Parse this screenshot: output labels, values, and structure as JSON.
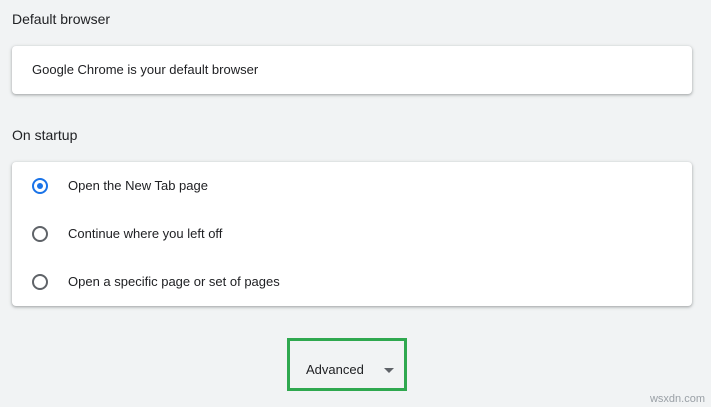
{
  "default_browser": {
    "section_title": "Default browser",
    "status_text": "Google Chrome is your default browser"
  },
  "on_startup": {
    "section_title": "On startup",
    "selected_index": 0,
    "options": [
      {
        "label": "Open the New Tab page",
        "checked": true
      },
      {
        "label": "Continue where you left off",
        "checked": false
      },
      {
        "label": "Open a specific page or set of pages",
        "checked": false
      }
    ]
  },
  "advanced": {
    "label": "Advanced",
    "icon": "arrow-drop-down-icon",
    "highlight_color": "#2fa84f"
  },
  "watermark": {
    "text": "wsxdn.com"
  },
  "colors": {
    "accent": "#1a73e8",
    "background": "#f1f3f4",
    "card": "#ffffff",
    "text": "#202124"
  }
}
